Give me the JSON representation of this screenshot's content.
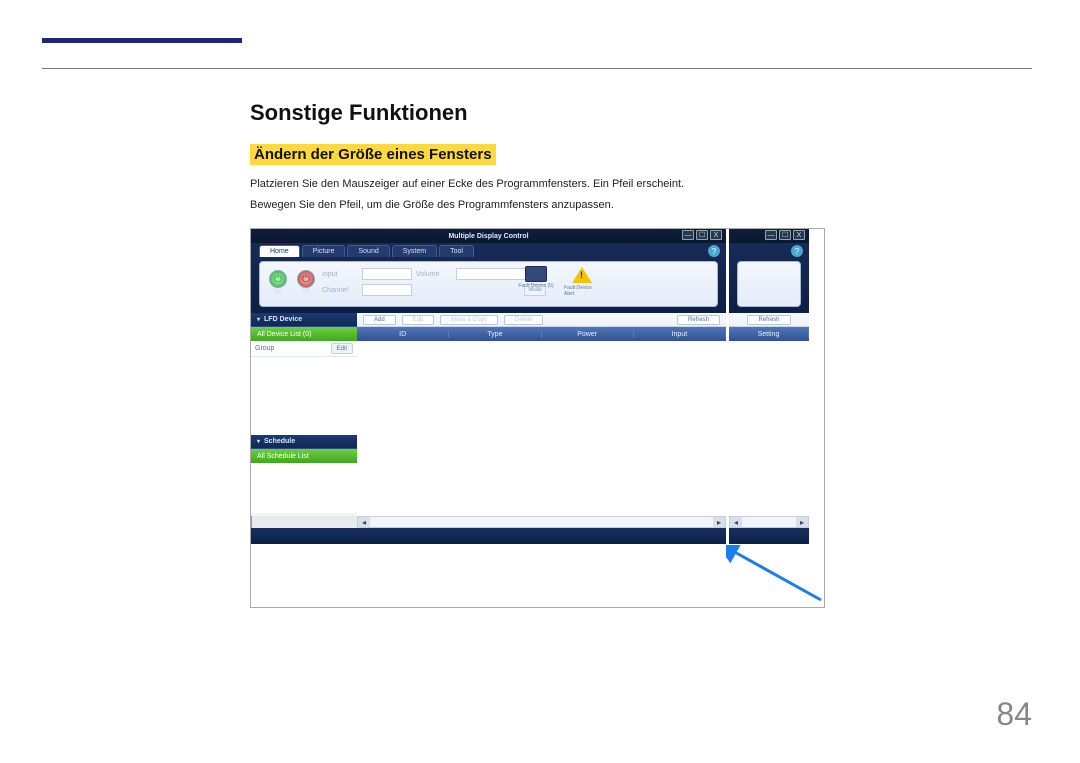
{
  "page": {
    "heading": "Sonstige Funktionen",
    "subheading": "Ändern der Größe eines Fensters",
    "paragraph1": "Platzieren Sie den Mauszeiger auf einer Ecke des Programmfensters. Ein Pfeil erscheint.",
    "paragraph2": "Bewegen Sie den Pfeil, um die Größe des Programmfensters anzupassen.",
    "number": "84"
  },
  "mdc": {
    "title": "Multiple Display Control",
    "win_min": "—",
    "win_max": "☐",
    "win_close": "X",
    "tabs": {
      "home": "Home",
      "picture": "Picture",
      "sound": "Sound",
      "system": "System",
      "tool": "Tool"
    },
    "help": "?",
    "fields": {
      "input_label": "Input",
      "channel_label": "Channel",
      "volume_label": "Volume",
      "mute": "Mute"
    },
    "power": {
      "on": "On",
      "off": "Off"
    },
    "status": {
      "fault0": "Fault Device (0)",
      "alert": "Fault Device Alert"
    },
    "sidebar": {
      "lfd": "LFD Device",
      "all_devices": "All Device List (0)",
      "group": "Group",
      "edit": "Edit",
      "schedule": "Schedule",
      "all_schedule": "All Schedule List"
    },
    "actions": {
      "add": "Add",
      "edit": "Edit",
      "move": "Move & Copy",
      "delete": "Delete",
      "refresh": "Refresh"
    },
    "columns": {
      "id": "ID",
      "type": "Type",
      "power": "Power",
      "input": "Input",
      "setting": "Setting"
    }
  }
}
